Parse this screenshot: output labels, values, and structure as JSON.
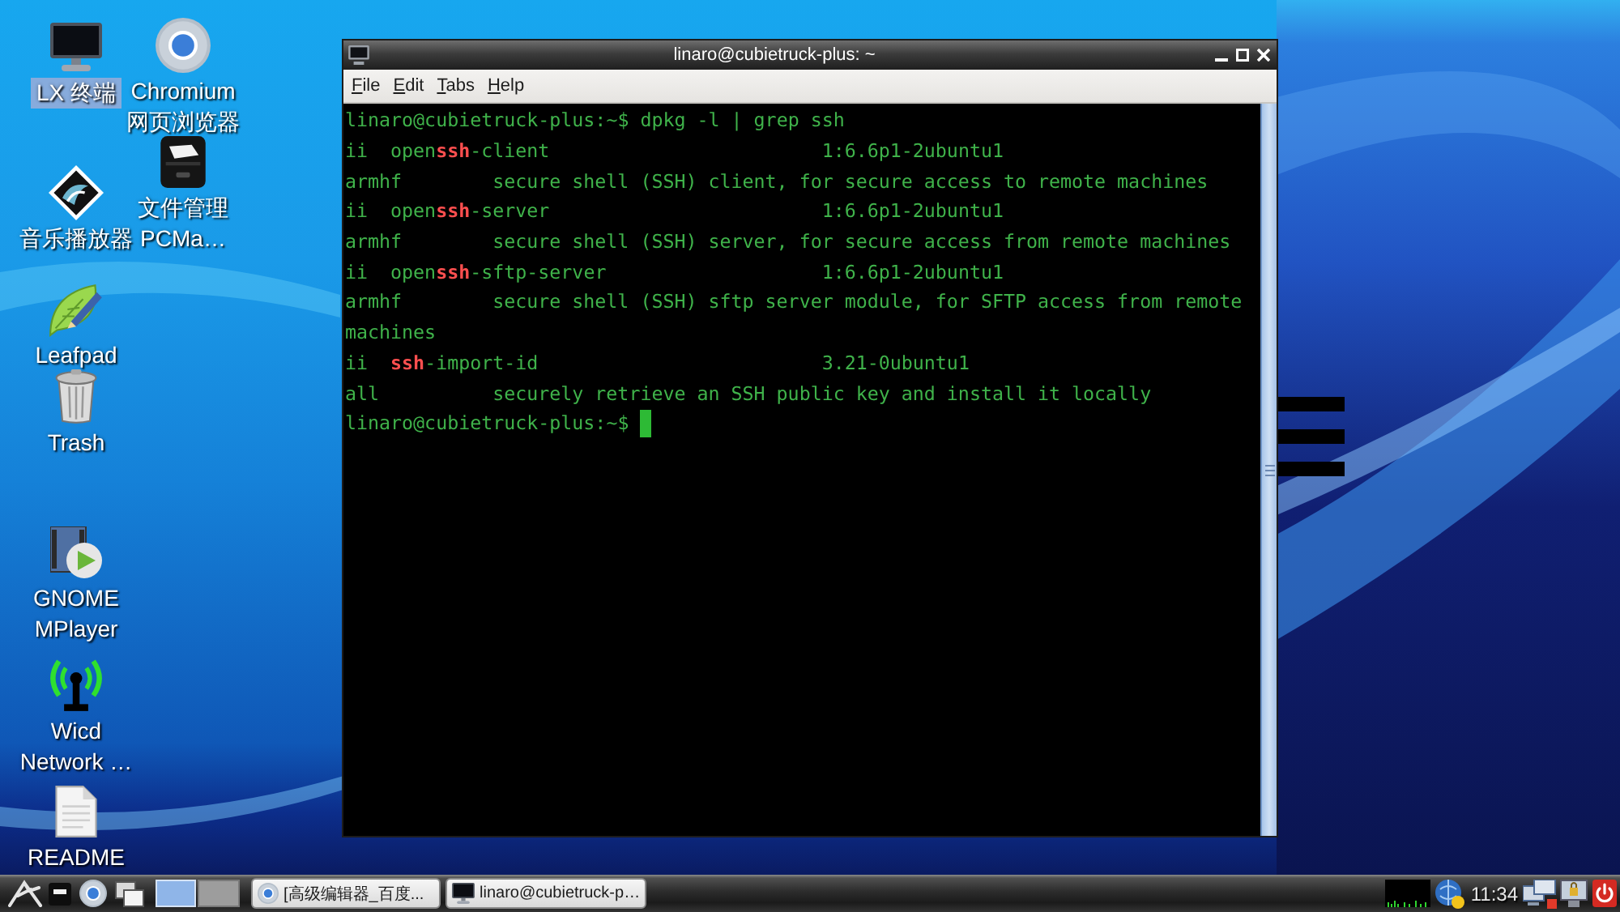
{
  "desktop": {
    "icons": [
      {
        "kind": "terminal",
        "label_lines": [
          "LX 终端"
        ],
        "selected": true
      },
      {
        "kind": "music-player",
        "label_lines": [
          "音乐播放器"
        ],
        "selected": false
      },
      {
        "kind": "text-editor",
        "label_lines": [
          "Leafpad"
        ],
        "selected": false
      },
      {
        "kind": "trash",
        "label_lines": [
          "Trash"
        ],
        "selected": false
      },
      {
        "kind": "video-player",
        "label_lines": [
          "GNOME",
          "MPlayer"
        ],
        "selected": false
      },
      {
        "kind": "network",
        "label_lines": [
          "Wicd",
          "Network …"
        ],
        "selected": false
      },
      {
        "kind": "document",
        "label_lines": [
          "README"
        ],
        "selected": false
      },
      {
        "kind": "browser",
        "label_lines": [
          "Chromium",
          "网页浏览器"
        ],
        "selected": false
      },
      {
        "kind": "file-manager",
        "label_lines": [
          "文件管理",
          "PCMa…"
        ],
        "selected": false
      }
    ]
  },
  "terminal_window": {
    "title": "linaro@cubietruck-plus: ~",
    "menu": [
      "File",
      "Edit",
      "Tabs",
      "Help"
    ],
    "lines": [
      {
        "kind": "prompt",
        "prompt": "linaro@cubietruck-plus:~$",
        "command": "dpkg -l | grep ssh",
        "cursor": false
      },
      {
        "kind": "package",
        "status": "ii",
        "name": "open**ssh**-client",
        "version": "1:6.6p1-2ubuntu1"
      },
      {
        "kind": "description",
        "arch": "armhf",
        "text": "secure shell (SSH) client, for secure access to remote machines"
      },
      {
        "kind": "package",
        "status": "ii",
        "name": "open**ssh**-server",
        "version": "1:6.6p1-2ubuntu1"
      },
      {
        "kind": "description",
        "arch": "armhf",
        "text": "secure shell (SSH) server, for secure access from remote machines"
      },
      {
        "kind": "package",
        "status": "ii",
        "name": "open**ssh**-sftp-server",
        "version": "1:6.6p1-2ubuntu1"
      },
      {
        "kind": "description",
        "arch": "armhf",
        "text": "secure shell (SSH) sftp server module, for SFTP access from remote"
      },
      {
        "kind": "continuation",
        "text": "machines"
      },
      {
        "kind": "package",
        "status": "ii",
        "name": "**ssh**-import-id",
        "version": "3.21-0ubuntu1"
      },
      {
        "kind": "description",
        "arch": "all",
        "text": "securely retrieve an SSH public key and install it locally"
      },
      {
        "kind": "prompt",
        "prompt": "linaro@cubietruck-plus:~$",
        "cursor": true
      }
    ]
  },
  "taskbar": {
    "workspaces": [
      {
        "selected": true
      },
      {
        "selected": false
      }
    ],
    "tasks": [
      {
        "kind": "browser",
        "label": "[高级编辑器_百度..."
      },
      {
        "kind": "terminal",
        "label": "linaro@cubietruck-p…"
      }
    ],
    "clock": "11:34"
  }
}
